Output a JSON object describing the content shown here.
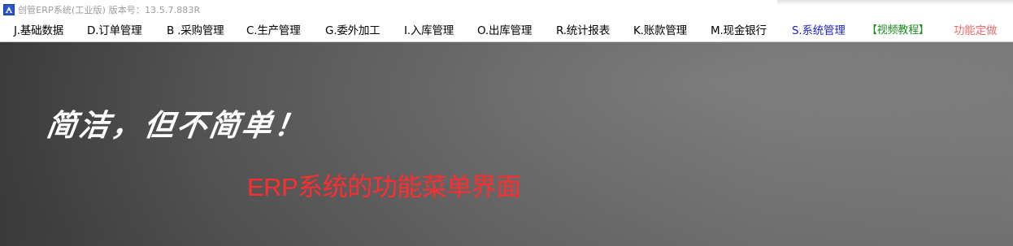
{
  "window": {
    "title": "创管ERP系统(工业版) 版本号：13.5.7.883R",
    "icon": "app-logo-icon"
  },
  "menu": {
    "items": [
      {
        "label": "J.基础数据",
        "color": "#000000"
      },
      {
        "label": "D.订单管理",
        "color": "#000000"
      },
      {
        "label": "B .采购管理",
        "color": "#000000"
      },
      {
        "label": "C.生产管理",
        "color": "#000000"
      },
      {
        "label": "G.委外加工",
        "color": "#000000"
      },
      {
        "label": "I.入库管理",
        "color": "#000000"
      },
      {
        "label": "O.出库管理",
        "color": "#000000"
      },
      {
        "label": "R.统计报表",
        "color": "#000000"
      },
      {
        "label": "K.账款管理",
        "color": "#000000"
      },
      {
        "label": "M.现金银行",
        "color": "#000000"
      },
      {
        "label": "S.系统管理",
        "color": "#1e22c8"
      },
      {
        "label": "【视频教程】",
        "color": "#1f8a1f"
      },
      {
        "label": "功能定做",
        "color": "#ee6a6a"
      }
    ]
  },
  "banner": {
    "slogan": "简洁，但不简单！",
    "caption": "ERP系统的功能菜单界面",
    "caption_color": "#ff2d2d"
  }
}
